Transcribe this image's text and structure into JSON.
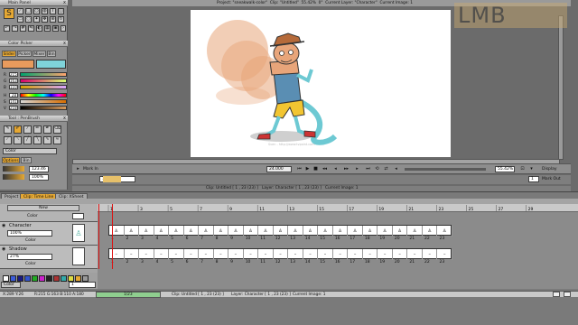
{
  "watermark": "LMB",
  "title_bar": {
    "project_label": "Project:",
    "project_value": "\"sneakwalk-color\"",
    "clip_label": "Clip:",
    "clip_value": "\"Untitled\"",
    "zoom": "55.42%",
    "rotation": "0°",
    "current_layer_label": "Current Layer:",
    "current_layer_value": "\"Character\"",
    "current_image_label": "Current Image:",
    "current_image_value": "1"
  },
  "main_panel": {
    "title": "Main Panel",
    "close": "x"
  },
  "color_picker": {
    "title": "Color Picker",
    "tabs": [
      "Slider",
      "Picker",
      "Mixer",
      "Bin"
    ],
    "active_tab": "Slider",
    "main_color": "#e89b5d",
    "secondary_color": "#7fd3da",
    "sliders": [
      {
        "label": "R",
        "value": "215"
      },
      {
        "label": "G",
        "value": "163"
      },
      {
        "label": "B",
        "value": "110"
      },
      {
        "label": "H",
        "value": "28"
      },
      {
        "label": "S",
        "value": "141"
      },
      {
        "label": "V",
        "value": "218"
      }
    ]
  },
  "tool_panel": {
    "title": "Tool : PenBrush",
    "color_dropdown": "Color",
    "options_tabs": [
      "Options",
      "Bin"
    ],
    "size_value": "123.46",
    "opacity_value": "100%"
  },
  "canvas": {
    "credit": "Sven - http://www.tvpaint.com"
  },
  "playback": {
    "mark_in": "Mark In",
    "mark_out": "Mark Out",
    "frame": "24.000",
    "zoom_value": "55.42%",
    "display": "Display",
    "start_frame": "1",
    "end_frame": "1"
  },
  "status_mid": {
    "clip_label": "Clip:",
    "clip_value": "Untitled [ 1 , 23 (23) ]",
    "layer_label": "Layer:",
    "layer_value": "Character [ 1 , 23 (23) ]",
    "current_image_label": "Current Image:",
    "current_image_value": "1"
  },
  "timeline_tabs": [
    "Project",
    "Clip: Time Line",
    "Clip: XSheet"
  ],
  "active_timeline_tab": "Clip: Time Line",
  "timeline": {
    "new_button": "New",
    "color_label": "Color",
    "frames": [
      "1",
      "2",
      "3",
      "4",
      "5",
      "6",
      "7",
      "8",
      "9",
      "10",
      "11",
      "12",
      "13",
      "14",
      "15",
      "16",
      "17",
      "18",
      "19",
      "20",
      "21",
      "22",
      "23"
    ],
    "ruler_marks": [
      "1",
      "3",
      "5",
      "7",
      "9",
      "11",
      "13",
      "15",
      "17",
      "19",
      "21",
      "23",
      "25",
      "27",
      "29"
    ],
    "layers": [
      {
        "name": "Character",
        "opacity": "100%",
        "mode": "Color"
      },
      {
        "name": "Shadow",
        "opacity": "27%",
        "mode": "Color"
      }
    ],
    "frame_field": "1"
  },
  "bottom_status": {
    "coords": "X:289 Y:26",
    "rgba": "R:215 G:163 B:110 A:180",
    "progress": "1/23",
    "clip": "Clip: Untitled [ 1 , 23 (23) ]",
    "layer": "Layer: Character [ 1 , 23 (23) ]",
    "current_image": "Current Image: 1"
  },
  "colors": {
    "accent": "#e6a833",
    "panel": "#8f8f8f",
    "redline": "#dd1111"
  }
}
